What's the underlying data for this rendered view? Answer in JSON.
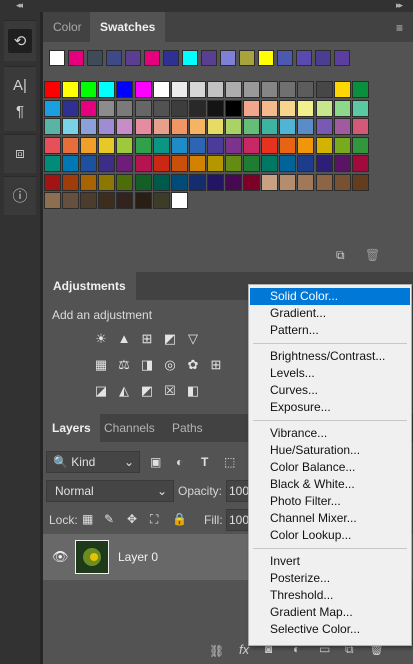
{
  "swatches_panel": {
    "tabs": [
      "Color",
      "Swatches"
    ],
    "active_tab": "Swatches",
    "recent_colors": [
      "#ffffff",
      "#e6007e",
      "#404b5a",
      "#3e4a87",
      "#5a3e92",
      "#e6007e",
      "#2e3192",
      "#00ffff",
      "#5a3e92",
      "#7f7fd5",
      "#a7a43e",
      "#ffff00",
      "#4b5ab0",
      "#5a4ab0",
      "#4b3e92",
      "#5a3ea0"
    ],
    "rows": [
      [
        "#ff0000",
        "#ffff00",
        "#00ff00",
        "#00ffff",
        "#0000ff",
        "#ff00ff",
        "#ffffff",
        "#ebebeb",
        "#d6d6d6",
        "#c2c2c2",
        "#adadad",
        "#999999",
        "#858585",
        "#707070",
        "#5c5c5c",
        "#474747",
        "#ffd700",
        "#0a8f3c"
      ],
      [
        "#1aa0e0",
        "#2e3192",
        "#e6007e",
        "#8c8c8c",
        "#7a7a7a",
        "#666666",
        "#525252",
        "#3d3d3d",
        "#292929",
        "#141414",
        "#000000",
        "#f2a68c",
        "#f5b98c",
        "#f7d58c",
        "#f0f08c",
        "#c8e68c",
        "#8cd98c",
        "#5ac8a0"
      ],
      [
        "#5ab4a5",
        "#7ad2e6",
        "#8ca0d9",
        "#a08cd2",
        "#c88cc8",
        "#e68ca0",
        "#e6a08c",
        "#f09664",
        "#f5b464",
        "#e6dc64",
        "#aad264",
        "#64be78",
        "#3cb4a0",
        "#50b4d2",
        "#5a8cc8",
        "#785ab4",
        "#a05aa0",
        "#d25a78"
      ],
      [
        "#e6505a",
        "#e66e3c",
        "#f0a028",
        "#e6c828",
        "#a0c83c",
        "#32a04b",
        "#0a9682",
        "#1e8cc8",
        "#2e64b4",
        "#4b3c9b",
        "#7d328c",
        "#c82864",
        "#e6321e",
        "#e66414",
        "#f0960a",
        "#d2b400",
        "#78aa1e",
        "#32963c"
      ],
      [
        "#008c78",
        "#0078b4",
        "#1e50a0",
        "#3c2d87",
        "#6e1e78",
        "#b41450",
        "#c82814",
        "#c8500a",
        "#d28200",
        "#b49600",
        "#648c14",
        "#1e7d32",
        "#007864",
        "#00649b",
        "#1e3c8c",
        "#2d1e78",
        "#5a1464",
        "#a00a3c"
      ],
      [
        "#a01414",
        "#a03c0a",
        "#a86400",
        "#8c7800",
        "#4b6e0a",
        "#145f28",
        "#005a4b",
        "#004b78",
        "#142d6e",
        "#231464",
        "#460a50",
        "#7d0028",
        "#c8a082",
        "#b48c6e",
        "#a0785a",
        "#8c6446",
        "#785032",
        "#643c1e"
      ],
      [
        "#8c6e50",
        "#64503c",
        "#4b3c2d",
        "#3c2d1e",
        "#32231e",
        "#281e14",
        "#3c3c28",
        "#ffffff"
      ]
    ],
    "row_counts_visible": [
      18,
      18,
      18,
      18,
      18,
      18,
      8
    ]
  },
  "adjustments_panel": {
    "title": "Adjustments",
    "hint": "Add an adjustment",
    "icons": [
      "brightness-icon",
      "levels-icon",
      "curves-icon",
      "exposure-icon",
      "vibrance-icon",
      "hue-saturation-icon",
      "color-balance-icon",
      "black-white-icon",
      "photo-filter-icon",
      "channel-mixer-icon",
      "color-lookup-icon",
      "invert-icon",
      "posterize-icon",
      "threshold-icon",
      "selective-color-icon",
      "gradient-map-icon"
    ]
  },
  "layers_panel": {
    "tabs": [
      "Layers",
      "Channels",
      "Paths"
    ],
    "active_tab": "Layers",
    "filter_kind": "Kind",
    "blend_mode": "Normal",
    "opacity_label": "Opacity:",
    "opacity_value": "100",
    "lock_label": "Lock:",
    "fill_label": "Fill:",
    "fill_value": "100",
    "layer_name": "Layer 0"
  },
  "menu": {
    "groups": [
      [
        "Solid Color...",
        "Gradient...",
        "Pattern..."
      ],
      [
        "Brightness/Contrast...",
        "Levels...",
        "Curves...",
        "Exposure..."
      ],
      [
        "Vibrance...",
        "Hue/Saturation...",
        "Color Balance...",
        "Black & White...",
        "Photo Filter...",
        "Channel Mixer...",
        "Color Lookup..."
      ],
      [
        "Invert",
        "Posterize...",
        "Threshold...",
        "Gradient Map...",
        "Selective Color..."
      ]
    ],
    "highlighted": "Solid Color...",
    "highlight_color": "#0078d7"
  }
}
